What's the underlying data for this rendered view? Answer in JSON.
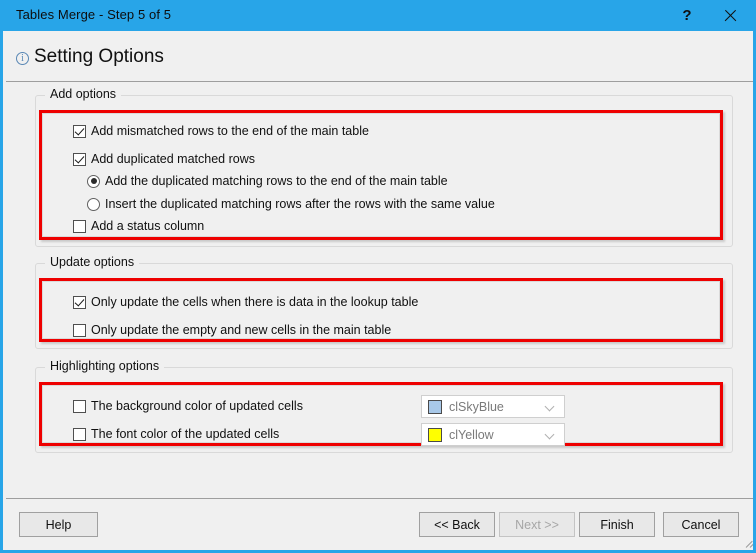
{
  "window": {
    "title": "Tables Merge - Step 5 of 5",
    "help_icon": "question-mark-icon",
    "close_icon": "close-icon",
    "accent_color": "#28a5e8"
  },
  "header": {
    "info_icon": "info-icon",
    "title": "Setting Options"
  },
  "groups": [
    {
      "label": "Add options",
      "options": [
        {
          "type": "checkbox",
          "checked": true,
          "label": "Add mismatched rows to the end of the main table"
        },
        {
          "type": "checkbox",
          "checked": true,
          "label": "Add duplicated matched rows"
        },
        {
          "type": "radio",
          "checked": true,
          "label": "Add the duplicated matching rows to the end of the main table"
        },
        {
          "type": "radio",
          "checked": false,
          "label": "Insert the duplicated matching rows after the rows with the same value"
        },
        {
          "type": "checkbox",
          "checked": false,
          "label": "Add a status column"
        }
      ]
    },
    {
      "label": "Update options",
      "options": [
        {
          "type": "checkbox",
          "checked": true,
          "label": "Only update the cells when there is data in the lookup table"
        },
        {
          "type": "checkbox",
          "checked": false,
          "label": "Only update the empty and new cells in the main table"
        }
      ]
    },
    {
      "label": "Highlighting options",
      "options": [
        {
          "type": "checkbox",
          "checked": false,
          "label": "The background color of updated cells"
        },
        {
          "type": "checkbox",
          "checked": false,
          "label": "The font color of the updated cells"
        }
      ],
      "combos": [
        {
          "value": "clSkyBlue",
          "swatch": "#a8c8e8",
          "chevron_icon": "chevron-down-icon"
        },
        {
          "value": "clYellow",
          "swatch": "#ffff00",
          "chevron_icon": "chevron-down-icon"
        }
      ]
    }
  ],
  "footer": {
    "help": "Help",
    "back": "<< Back",
    "next": "Next >>",
    "finish": "Finish",
    "cancel": "Cancel"
  }
}
